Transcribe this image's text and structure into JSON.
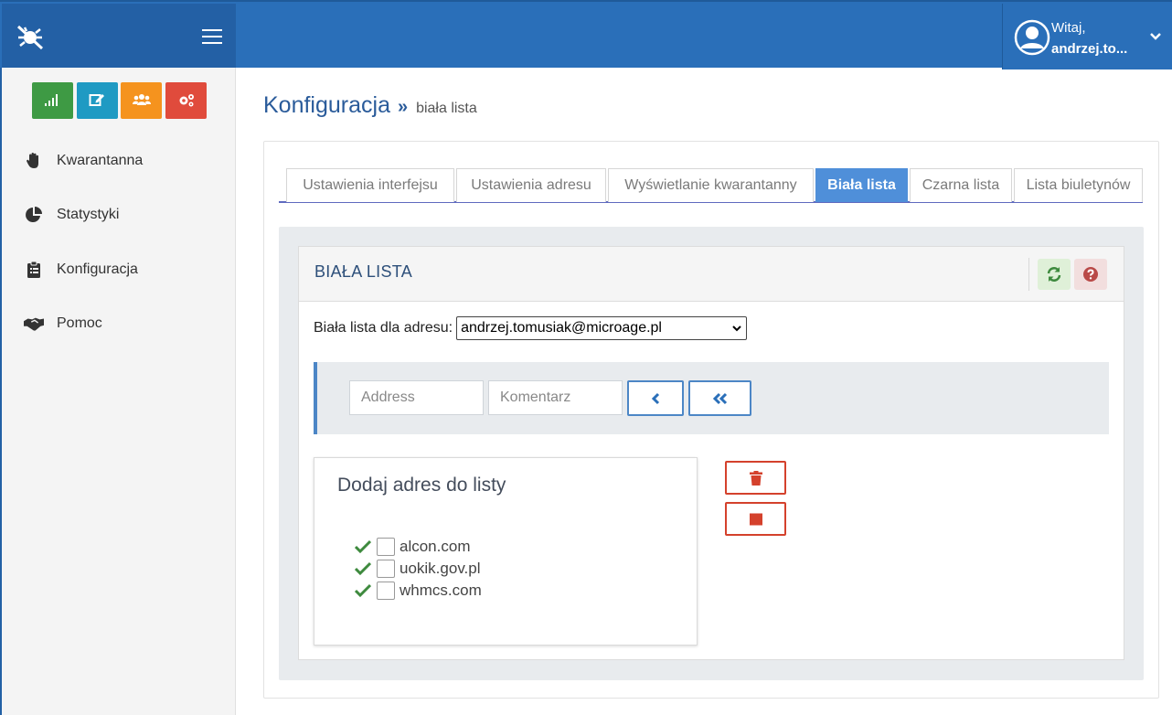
{
  "topbar": {
    "user": {
      "greeting": "Witaj,",
      "name": "andrzej.to..."
    }
  },
  "sidebar": {
    "quick_buttons": [
      {
        "icon": "signal-bars-icon",
        "color": "#3e9a44"
      },
      {
        "icon": "edit-icon",
        "color": "#1f9ac3"
      },
      {
        "icon": "users-icon",
        "color": "#f5931e"
      },
      {
        "icon": "gears-icon",
        "color": "#e04b3c"
      }
    ],
    "items": [
      {
        "label": "Kwarantanna",
        "icon": "hand-icon"
      },
      {
        "label": "Statystyki",
        "icon": "pie-chart-icon"
      },
      {
        "label": "Konfiguracja",
        "icon": "clipboard-icon"
      },
      {
        "label": "Pomoc",
        "icon": "handshake-icon"
      }
    ]
  },
  "page": {
    "title": "Konfiguracja",
    "separator": "»",
    "breadcrumb": "biała lista"
  },
  "tabs": [
    {
      "label": "Ustawienia interfejsu",
      "active": false
    },
    {
      "label": "Ustawienia adresu",
      "active": false
    },
    {
      "label": "Wyświetlanie kwarantanny",
      "active": false
    },
    {
      "label": "Biała lista",
      "active": true
    },
    {
      "label": "Czarna lista",
      "active": false
    },
    {
      "label": "Lista biuletynów",
      "active": false
    }
  ],
  "panel": {
    "title": "BIAŁA LISTA",
    "refresh_icon": "refresh-icon",
    "help_icon": "question-circle-icon",
    "address_label": "Biała lista dla adresu:",
    "address_selected": "andrzej.tomusiak@microage.pl",
    "address_input_placeholder": "Address",
    "comment_input_placeholder": "Komentarz"
  },
  "whitelist": {
    "title": "Dodaj adres do listy",
    "entries": [
      "alcon.com",
      "uokik.gov.pl",
      "whmcs.com"
    ]
  },
  "colors": {
    "topbar": "#2a6fb9",
    "accent": "#4f8fd9",
    "danger": "#d4412c",
    "success": "#3e8a3e"
  }
}
